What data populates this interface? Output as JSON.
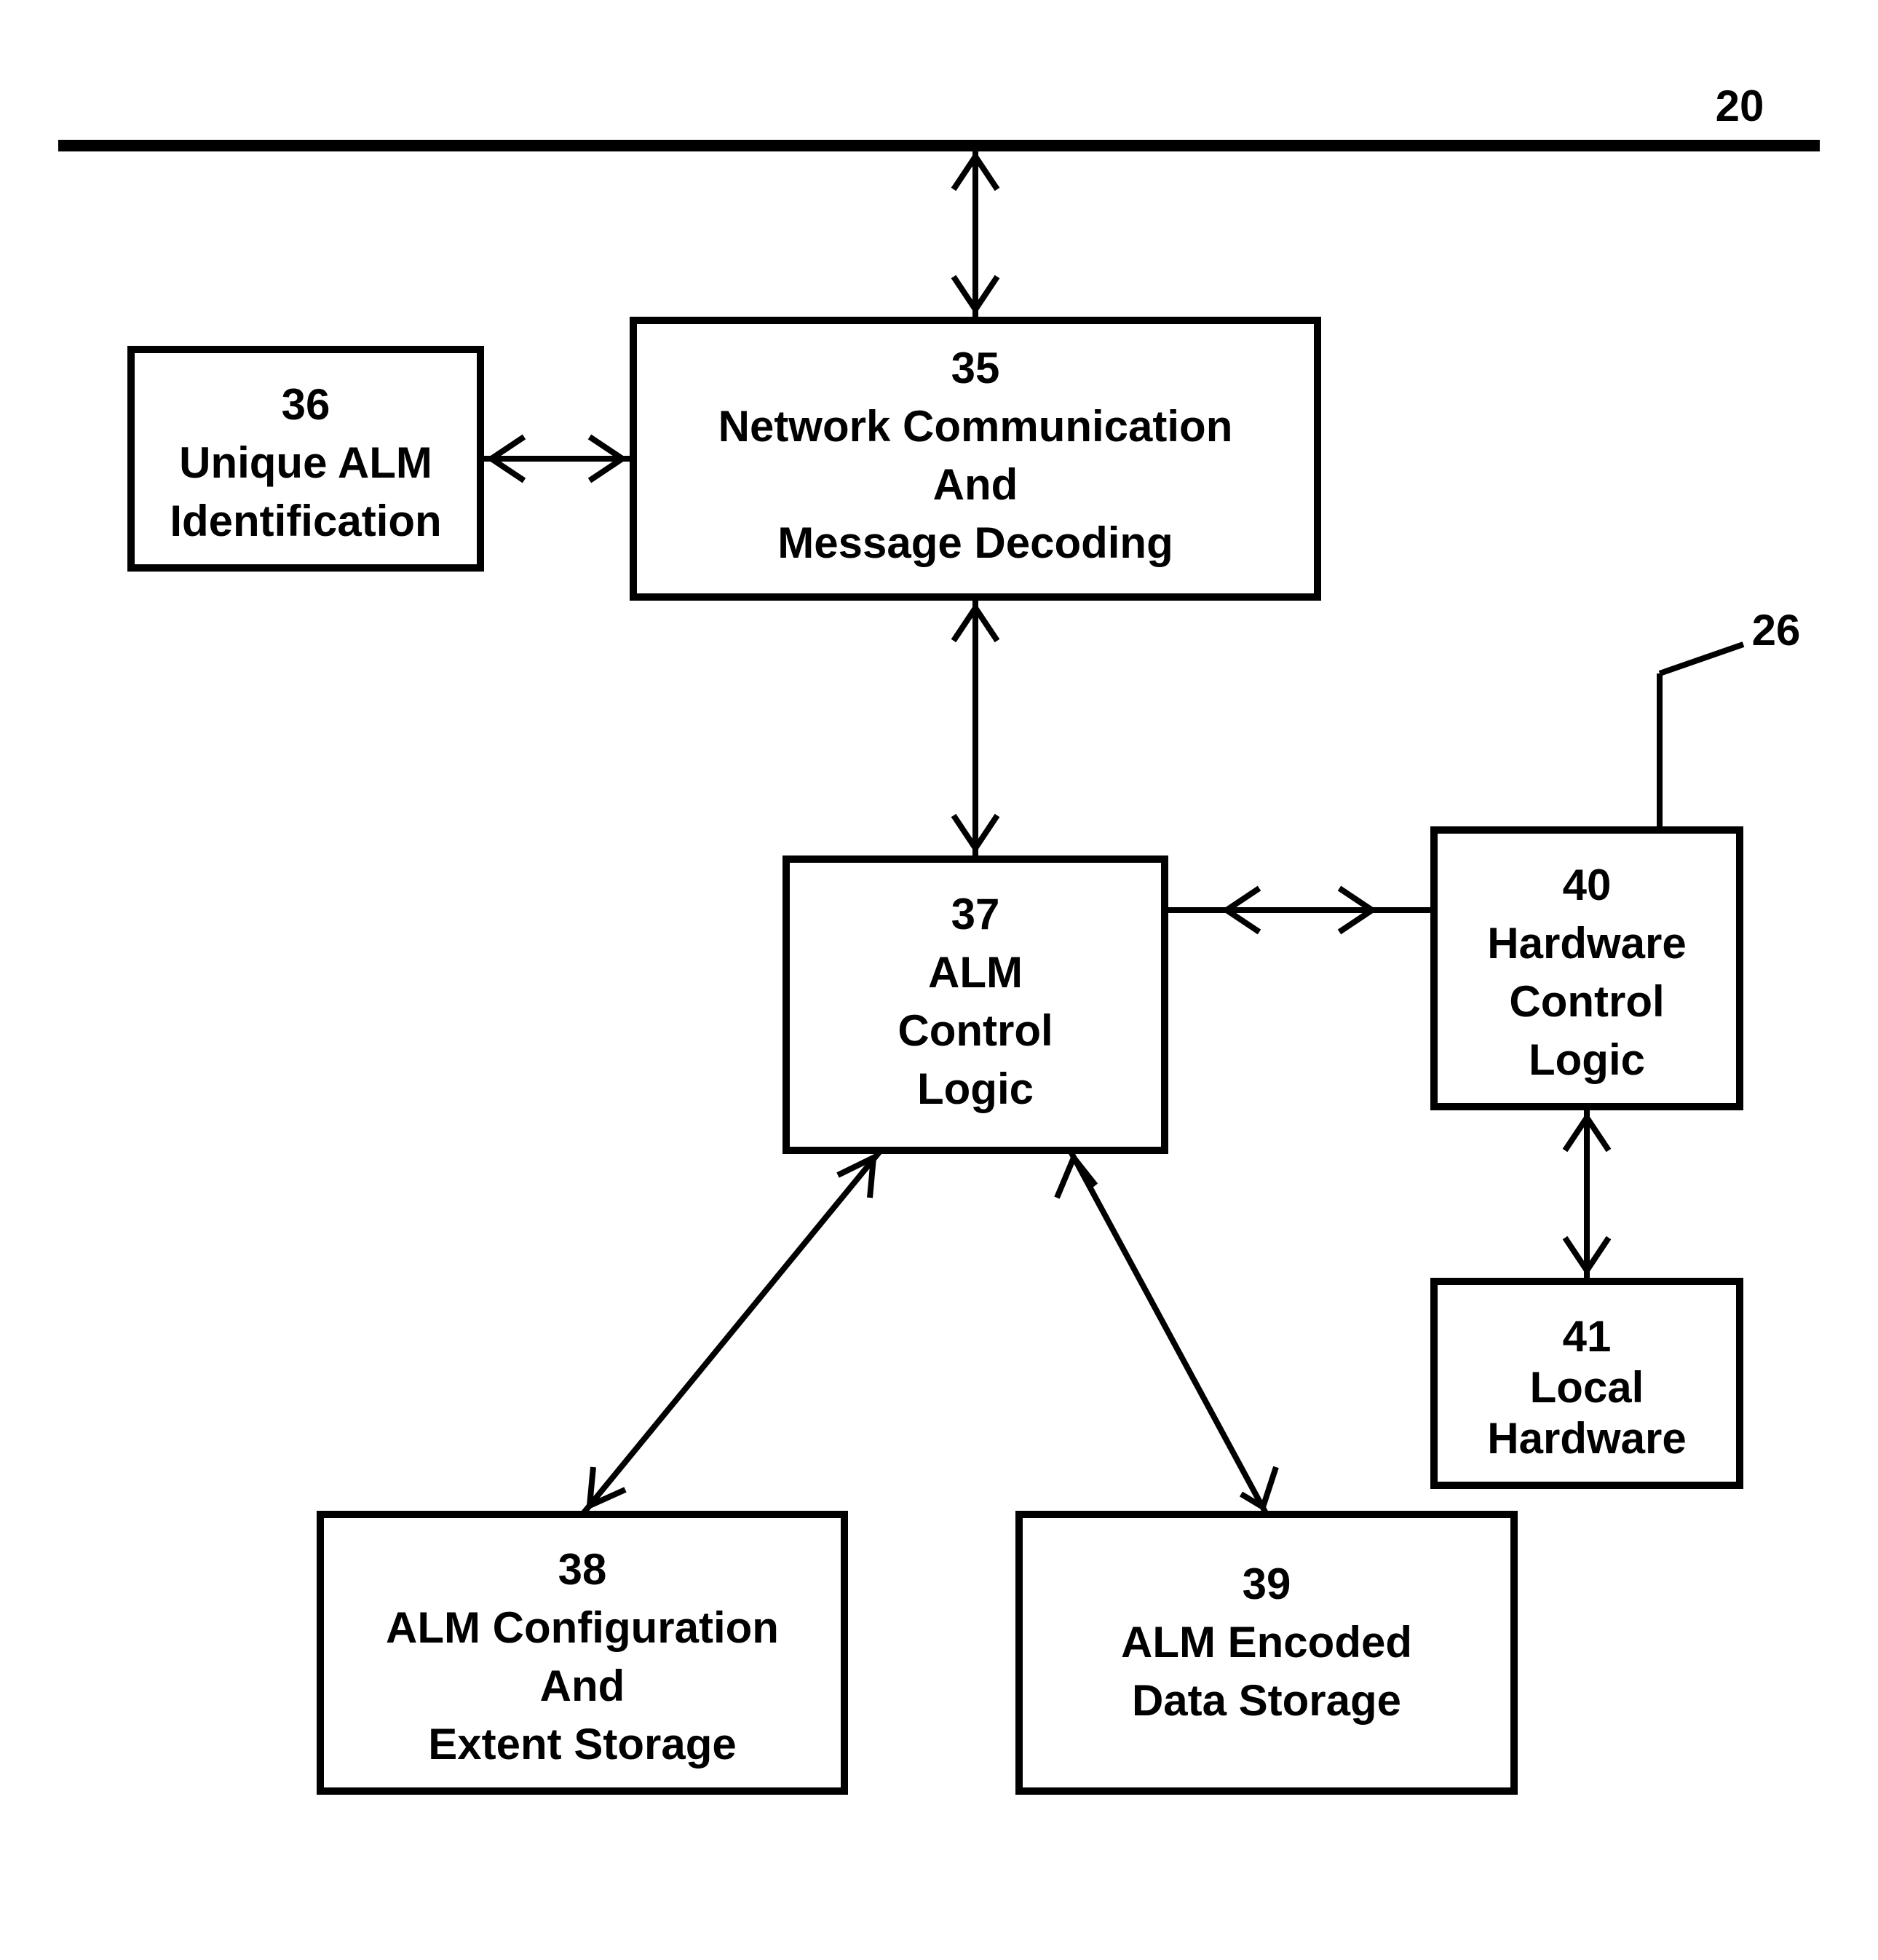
{
  "bus_label": "20",
  "leader_label": "26",
  "boxes": {
    "b35": {
      "num": "35",
      "lines": [
        "Network Communication",
        "And",
        "Message Decoding"
      ]
    },
    "b36": {
      "num": "36",
      "lines": [
        "Unique ALM",
        "Identification"
      ]
    },
    "b37": {
      "num": "37",
      "lines": [
        "ALM",
        "Control",
        "Logic"
      ]
    },
    "b38": {
      "num": "38",
      "lines": [
        "ALM Configuration",
        "And",
        "Extent Storage"
      ]
    },
    "b39": {
      "num": "39",
      "lines": [
        "ALM Encoded",
        "Data Storage"
      ]
    },
    "b40": {
      "num": "40",
      "lines": [
        "Hardware",
        "Control",
        "Logic"
      ]
    },
    "b41": {
      "num": "41",
      "lines": [
        "Local",
        "Hardware"
      ]
    }
  }
}
